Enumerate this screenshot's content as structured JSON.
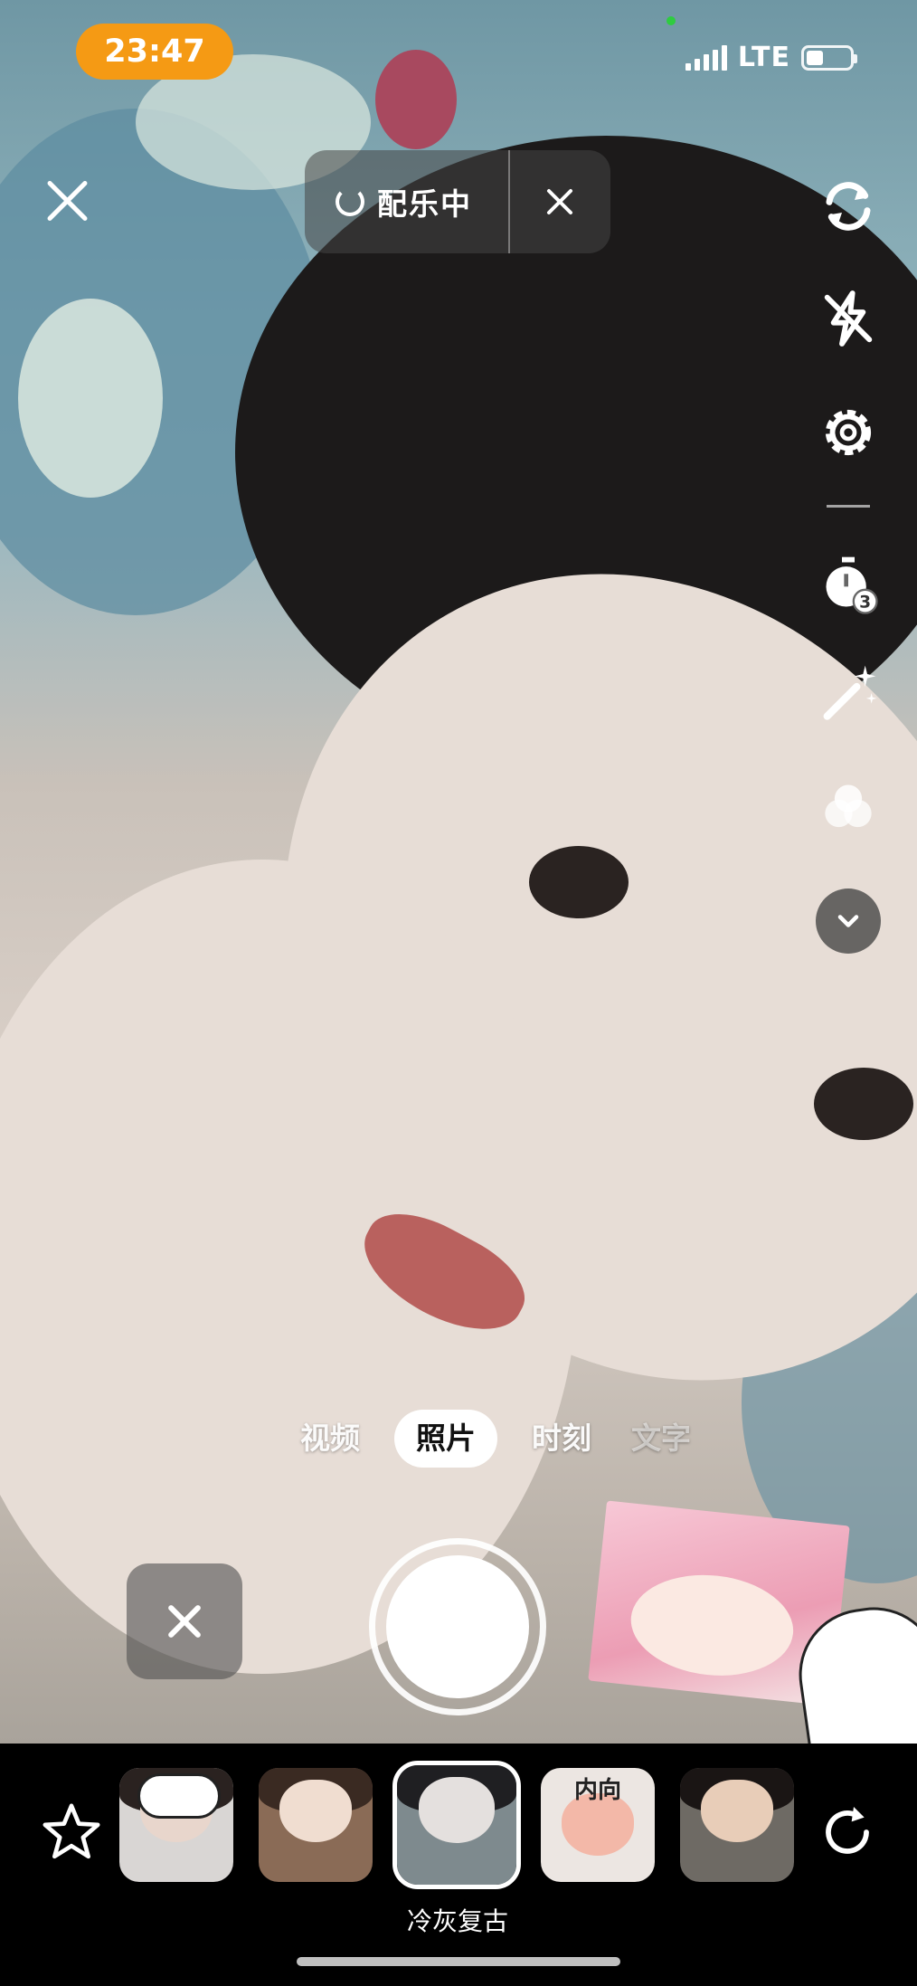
{
  "status_bar": {
    "time": "23:47",
    "network": "LTE"
  },
  "music": {
    "label": "配乐中"
  },
  "right_toolbar": [
    "flip-camera-icon",
    "flash-off-icon",
    "settings-gear-icon",
    "timer-3-icon",
    "beauty-wand-icon",
    "filter-circles-icon",
    "chevron-down-icon"
  ],
  "modes": [
    {
      "label": "视频",
      "state": "normal"
    },
    {
      "label": "照片",
      "state": "active"
    },
    {
      "label": "时刻",
      "state": "normal"
    },
    {
      "label": "文字",
      "state": "faded"
    }
  ],
  "filters": {
    "thumbnails": [
      {
        "name": "panda-ears",
        "text": ""
      },
      {
        "name": "soft-portrait",
        "text": ""
      },
      {
        "name": "cold-grey-retro",
        "text": "",
        "selected": true
      },
      {
        "name": "funny-face",
        "text": "内向"
      },
      {
        "name": "glam",
        "text": ""
      }
    ],
    "selected_label": "冷灰复古"
  },
  "colors": {
    "time_pill": "#f59a14",
    "active_mode_bg": "#ffffff"
  }
}
